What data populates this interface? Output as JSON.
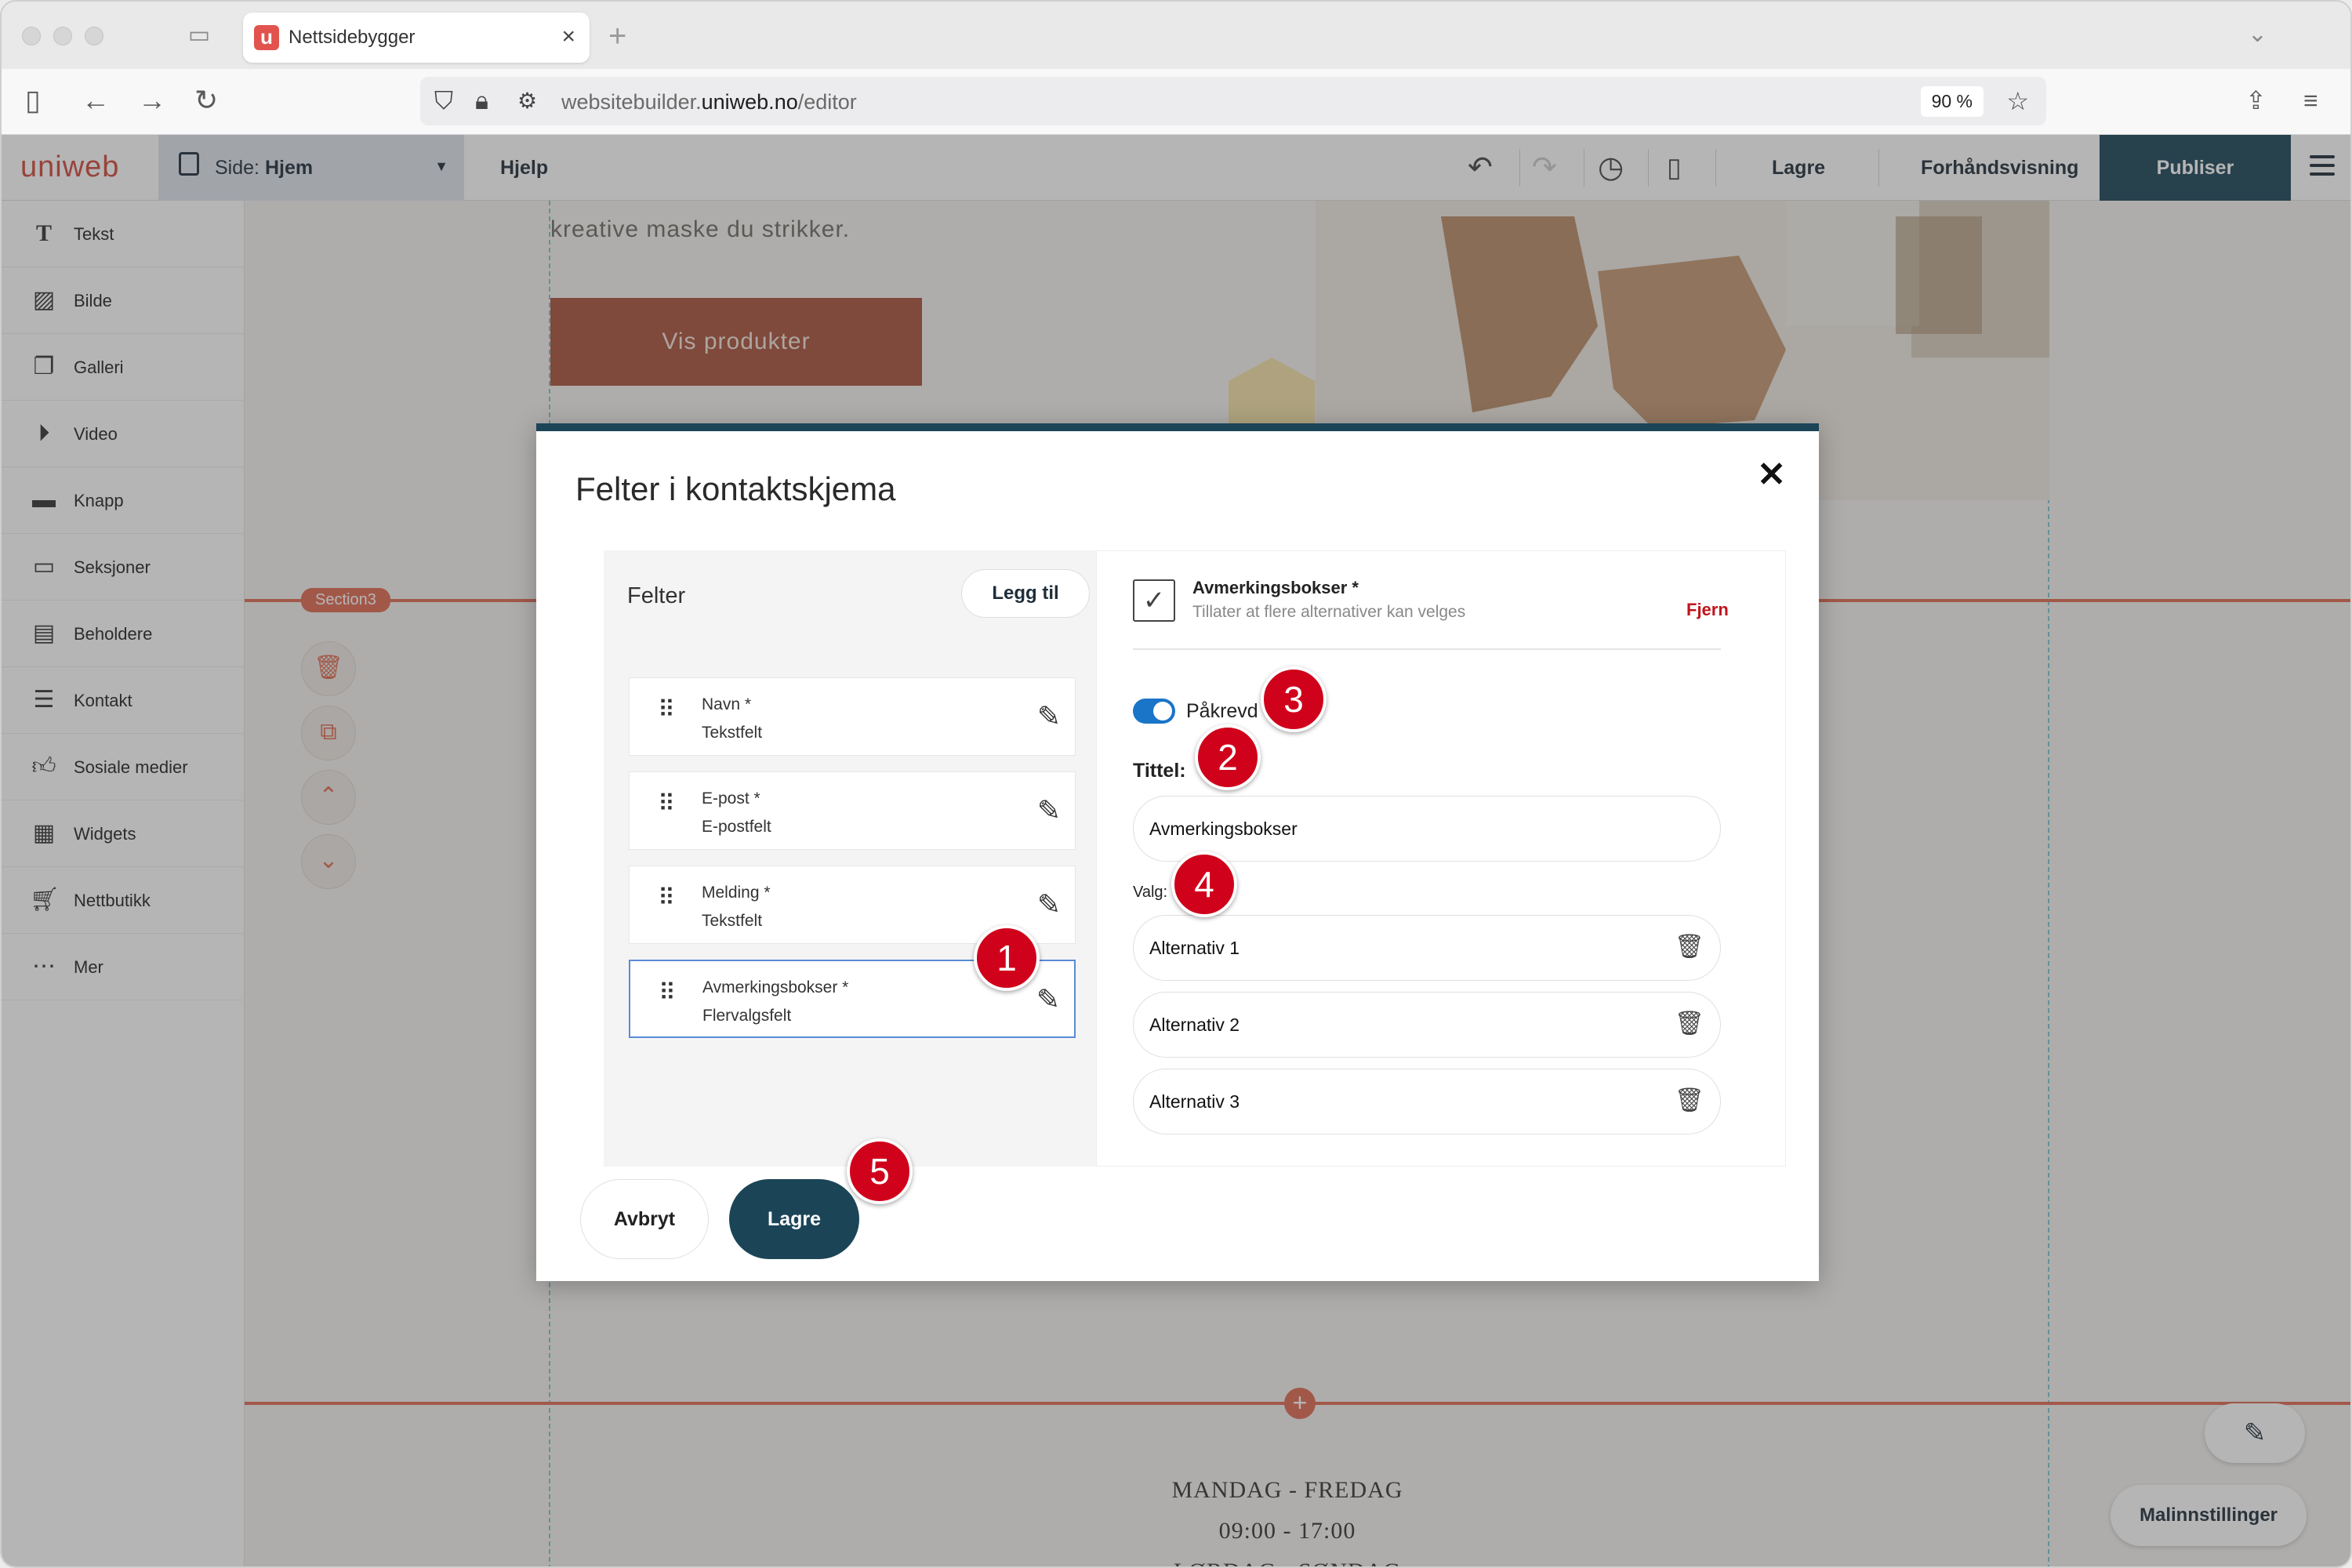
{
  "browser": {
    "tab_title": "Nettsidebygger",
    "favicon_letter": "u",
    "url_prefix": "websitebuilder.",
    "url_domain": "uniweb.no",
    "url_path": "/editor",
    "zoom": "90 %"
  },
  "toolbar": {
    "logo": "uniweb",
    "page_prefix": "Side: ",
    "page_name": "Hjem",
    "help": "Hjelp",
    "save": "Lagre",
    "preview": "Forhåndsvisning",
    "publish": "Publiser"
  },
  "sidebar": {
    "items": [
      {
        "label": "Tekst",
        "icon": "text-icon"
      },
      {
        "label": "Bilde",
        "icon": "image-icon"
      },
      {
        "label": "Galleri",
        "icon": "gallery-icon"
      },
      {
        "label": "Video",
        "icon": "video-icon"
      },
      {
        "label": "Knapp",
        "icon": "button-icon"
      },
      {
        "label": "Seksjoner",
        "icon": "section-icon"
      },
      {
        "label": "Beholdere",
        "icon": "container-icon"
      },
      {
        "label": "Kontakt",
        "icon": "contact-icon"
      },
      {
        "label": "Sosiale medier",
        "icon": "thumbs-up-icon"
      },
      {
        "label": "Widgets",
        "icon": "widgets-icon"
      },
      {
        "label": "Nettbutikk",
        "icon": "cart-icon"
      },
      {
        "label": "Mer",
        "icon": "more-icon"
      }
    ]
  },
  "canvas": {
    "hero_text": "kreative maske du strikker.",
    "cta": "Vis produkter",
    "section_badge": "Section3",
    "hours_line1": "MANDAG - FREDAG",
    "hours_line2": "09:00 - 17:00",
    "hours_line3": "LØRDAG - SØNDAG",
    "template_settings": "Malinnstillinger"
  },
  "modal": {
    "title": "Felter i kontaktskjema",
    "fields_heading": "Felter",
    "add_button": "Legg til",
    "fields": [
      {
        "name": "Navn *",
        "type": "Tekstfelt"
      },
      {
        "name": "E-post *",
        "type": "E-postfelt"
      },
      {
        "name": "Melding *",
        "type": "Tekstfelt"
      },
      {
        "name": "Avmerkingsbokser *",
        "type": "Flervalgsfelt"
      }
    ],
    "detail": {
      "type_title": "Avmerkingsbokser *",
      "type_desc": "Tillater at flere alternativer kan velges",
      "remove": "Fjern",
      "required_label": "Påkrevd",
      "required_on": true,
      "title_label": "Tittel:",
      "title_value": "Avmerkingsbokser",
      "choices_label": "Valg:",
      "choices": [
        "Alternativ 1",
        "Alternativ 2",
        "Alternativ 3"
      ]
    },
    "cancel": "Avbryt",
    "save": "Lagre"
  },
  "markers": [
    "1",
    "2",
    "3",
    "4",
    "5"
  ],
  "colors": {
    "brand_dark": "#1b4557",
    "accent": "#e06a52",
    "marker": "#d0021b",
    "toggle": "#1a74c8"
  }
}
